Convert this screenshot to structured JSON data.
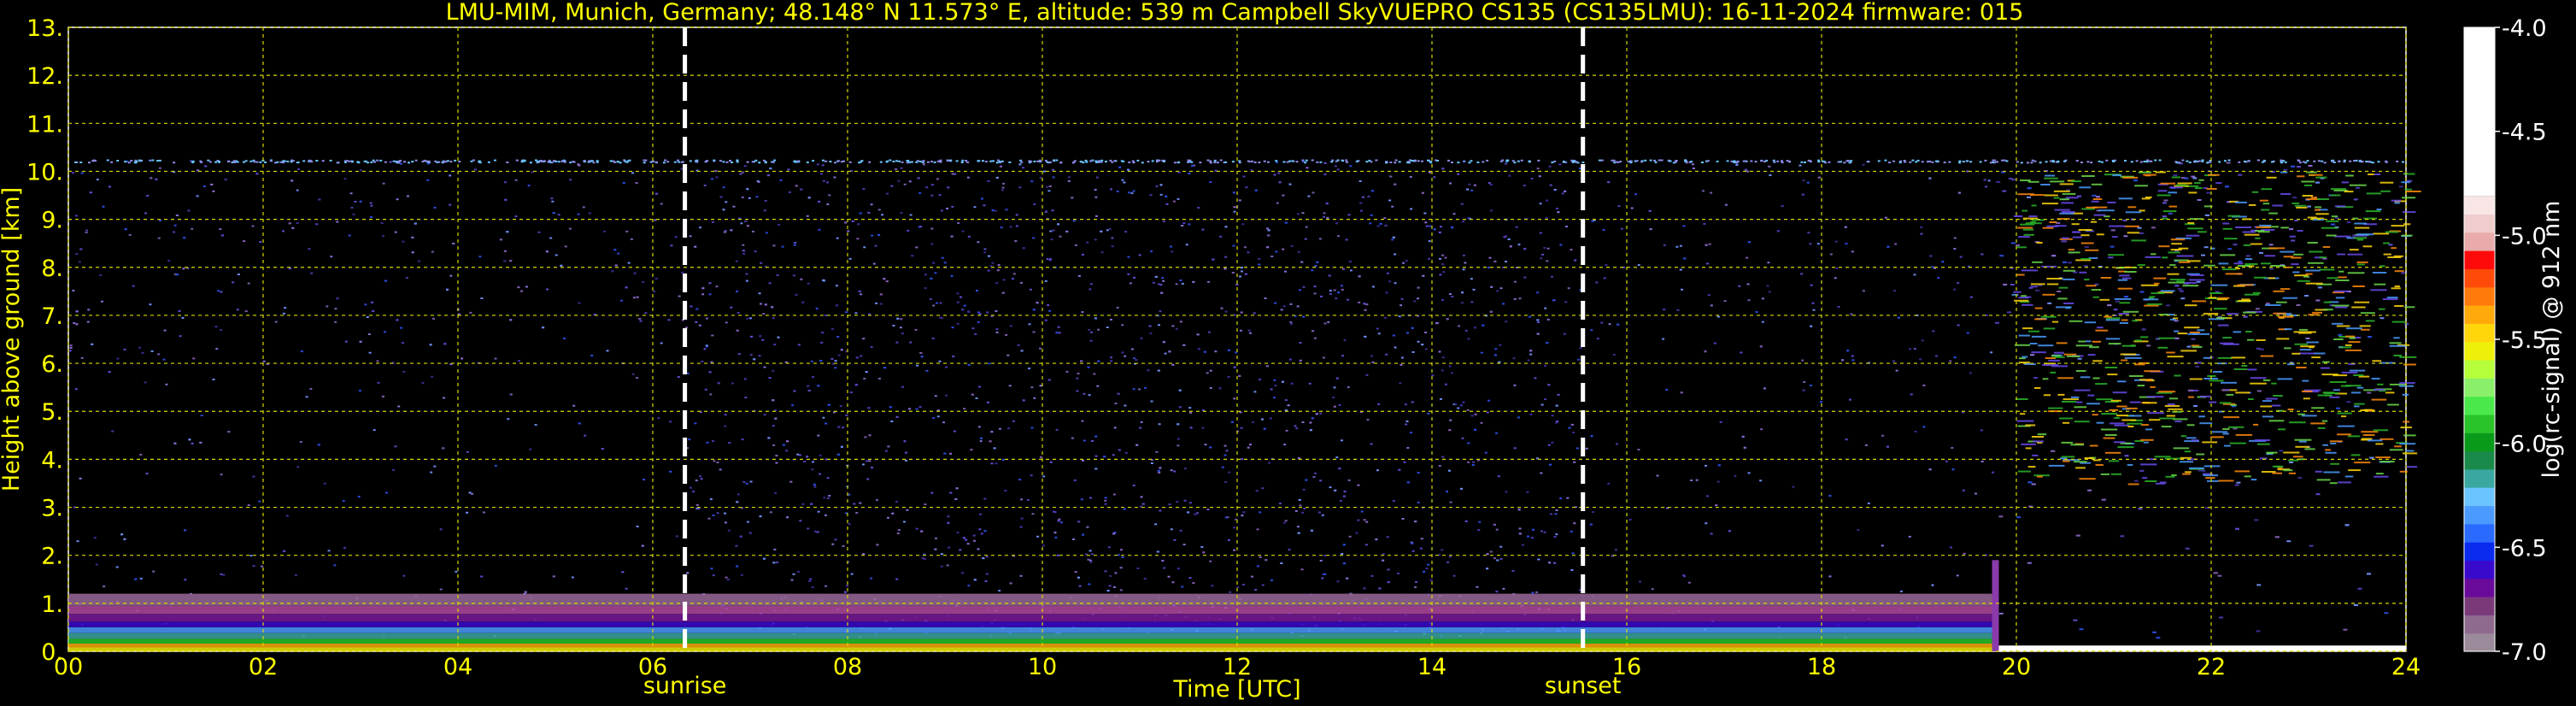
{
  "chart_data": {
    "type": "heatmap",
    "title": "LMU-MIM, Munich, Germany; 48.148° N 11.573° E, altitude: 539 m    Campbell SkyVUEPRO CS135 (CS135LMU): 16-11-2024    firmware: 015",
    "xlabel": "Time [UTC]",
    "ylabel": "Height above ground [km]",
    "xlim": [
      0,
      24
    ],
    "ylim": [
      0,
      13
    ],
    "x_ticks": [
      "00",
      "02",
      "04",
      "06",
      "08",
      "10",
      "12",
      "14",
      "16",
      "18",
      "20",
      "22",
      "24"
    ],
    "y_ticks": [
      "0.",
      "1.",
      "2.",
      "3.",
      "4.",
      "5.",
      "6.",
      "7.",
      "8.",
      "9.",
      "10.",
      "11.",
      "12.",
      "13."
    ],
    "grid": true,
    "colorbar": {
      "label": "log(rc-signal) @ 912 nm",
      "range": [
        -7.0,
        -4.0
      ],
      "ticks": [
        "-4.0",
        "-4.5",
        "-5.0",
        "-5.5",
        "-6.0",
        "-6.5",
        "-7.0"
      ],
      "colors": [
        "#9a8a9a",
        "#8f6a8f",
        "#7a3a7a",
        "#6a0a9a",
        "#3a0acc",
        "#0a2aee",
        "#2a6aff",
        "#4a9aff",
        "#6ac4ff",
        "#3aa8a0",
        "#1a8a4a",
        "#0a9a1a",
        "#2ac42a",
        "#4ae84a",
        "#8af06a",
        "#b4ff3a",
        "#eef00a",
        "#ffd60a",
        "#ffaa0a",
        "#ff7a0a",
        "#ff4a0a",
        "#ff0a0a",
        "#e8aaaa",
        "#f0cccc",
        "#f8e6e6",
        "#ffffff"
      ]
    },
    "markers": [
      {
        "label": "sunrise",
        "x": 6.33
      },
      {
        "label": "sunset",
        "x": 15.55
      }
    ],
    "signal_top_km": 10.25,
    "change_time": 19.75
  }
}
